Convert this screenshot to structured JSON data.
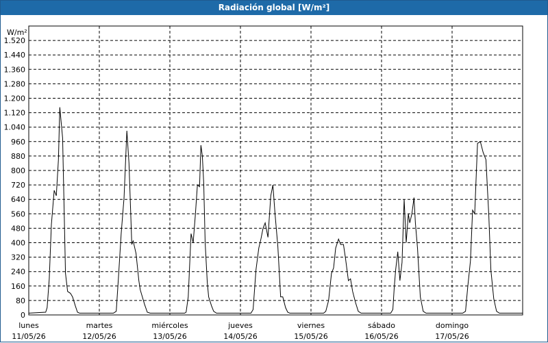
{
  "window": {
    "title": "Radiación global [W/m²]"
  },
  "chart_data": {
    "type": "line",
    "title": "Radiación global [W/m²]",
    "ylabel": "W/m²",
    "ylim": [
      0,
      1600
    ],
    "yticks": [
      0,
      80,
      160,
      240,
      320,
      400,
      480,
      560,
      640,
      720,
      800,
      880,
      960,
      1040,
      1120,
      1200,
      1280,
      1360,
      1440,
      1520
    ],
    "yticklabels": [
      "0",
      "80",
      "160",
      "240",
      "320",
      "400",
      "480",
      "560",
      "640",
      "720",
      "800",
      "880",
      "960",
      "1.040",
      "1.120",
      "1.200",
      "1.280",
      "1.360",
      "1.440",
      "1.520"
    ],
    "xlim": [
      0,
      7
    ],
    "days": [
      {
        "name": "lunes",
        "date": "11/05/26"
      },
      {
        "name": "martes",
        "date": "12/05/26"
      },
      {
        "name": "miércoles",
        "date": "13/05/26"
      },
      {
        "name": "jueves",
        "date": "14/05/26"
      },
      {
        "name": "viernes",
        "date": "15/05/26"
      },
      {
        "name": "sábado",
        "date": "16/05/26"
      },
      {
        "name": "domingo",
        "date": "17/05/26"
      }
    ],
    "grid": true,
    "line_color": "#000000",
    "series": [
      {
        "x": [
          0.0,
          0.24,
          0.26,
          0.29,
          0.32,
          0.36,
          0.39,
          0.42,
          0.44,
          0.48,
          0.52,
          0.55,
          0.59,
          0.62,
          0.66,
          0.69,
          0.72,
          0.79,
          0.85,
          1.0,
          1.2,
          1.24,
          1.27,
          1.31,
          1.35,
          1.39,
          1.42,
          1.46,
          1.48,
          1.52,
          1.56,
          1.58,
          1.61,
          1.64,
          1.68,
          1.72,
          1.76,
          1.79,
          1.82,
          2.0,
          2.21,
          2.23,
          2.26,
          2.3,
          2.33,
          2.36,
          2.39,
          2.42,
          2.44,
          2.46,
          2.48,
          2.5,
          2.53,
          2.55,
          2.59,
          2.62,
          2.66,
          2.71,
          2.76,
          2.82,
          3.0,
          3.15,
          3.18,
          3.22,
          3.26,
          3.29,
          3.32,
          3.35,
          3.39,
          3.43,
          3.46,
          3.49,
          3.53,
          3.57,
          3.6,
          3.64,
          3.67,
          3.7,
          3.74,
          3.78,
          4.0,
          4.18,
          4.21,
          4.25,
          4.29,
          4.32,
          4.35,
          4.39,
          4.42,
          4.46,
          4.49,
          4.53,
          4.56,
          4.59,
          4.63,
          4.67,
          4.71,
          4.76,
          5.0,
          5.13,
          5.16,
          5.18,
          5.2,
          5.23,
          5.26,
          5.29,
          5.32,
          5.35,
          5.38,
          5.4,
          5.43,
          5.46,
          5.48,
          5.51,
          5.55,
          5.59,
          5.63,
          5.68,
          6.0,
          6.15,
          6.19,
          6.22,
          6.26,
          6.29,
          6.32,
          6.36,
          6.4,
          6.44,
          6.48,
          6.52,
          6.55,
          6.59,
          6.63,
          6.67,
          6.71,
          6.76,
          6.82,
          7.0
        ],
        "y": [
          10,
          15,
          40,
          200,
          500,
          690,
          660,
          860,
          1150,
          980,
          230,
          130,
          120,
          100,
          50,
          15,
          10,
          10,
          10,
          10,
          10,
          20,
          200,
          450,
          650,
          1020,
          840,
          390,
          410,
          340,
          190,
          140,
          100,
          60,
          15,
          10,
          10,
          10,
          10,
          10,
          10,
          15,
          100,
          450,
          400,
          550,
          720,
          710,
          940,
          880,
          730,
          400,
          180,
          100,
          50,
          20,
          10,
          10,
          10,
          10,
          10,
          10,
          30,
          250,
          370,
          420,
          480,
          510,
          430,
          660,
          720,
          560,
          380,
          100,
          100,
          40,
          15,
          10,
          10,
          10,
          10,
          10,
          20,
          80,
          230,
          260,
          370,
          420,
          390,
          390,
          310,
          190,
          200,
          130,
          70,
          20,
          10,
          10,
          10,
          10,
          30,
          150,
          250,
          350,
          190,
          290,
          640,
          400,
          560,
          510,
          560,
          650,
          510,
          370,
          100,
          20,
          10,
          10,
          10,
          10,
          20,
          150,
          300,
          580,
          560,
          950,
          960,
          900,
          860,
          550,
          250,
          90,
          20,
          10,
          10,
          10,
          10,
          10
        ]
      }
    ]
  }
}
